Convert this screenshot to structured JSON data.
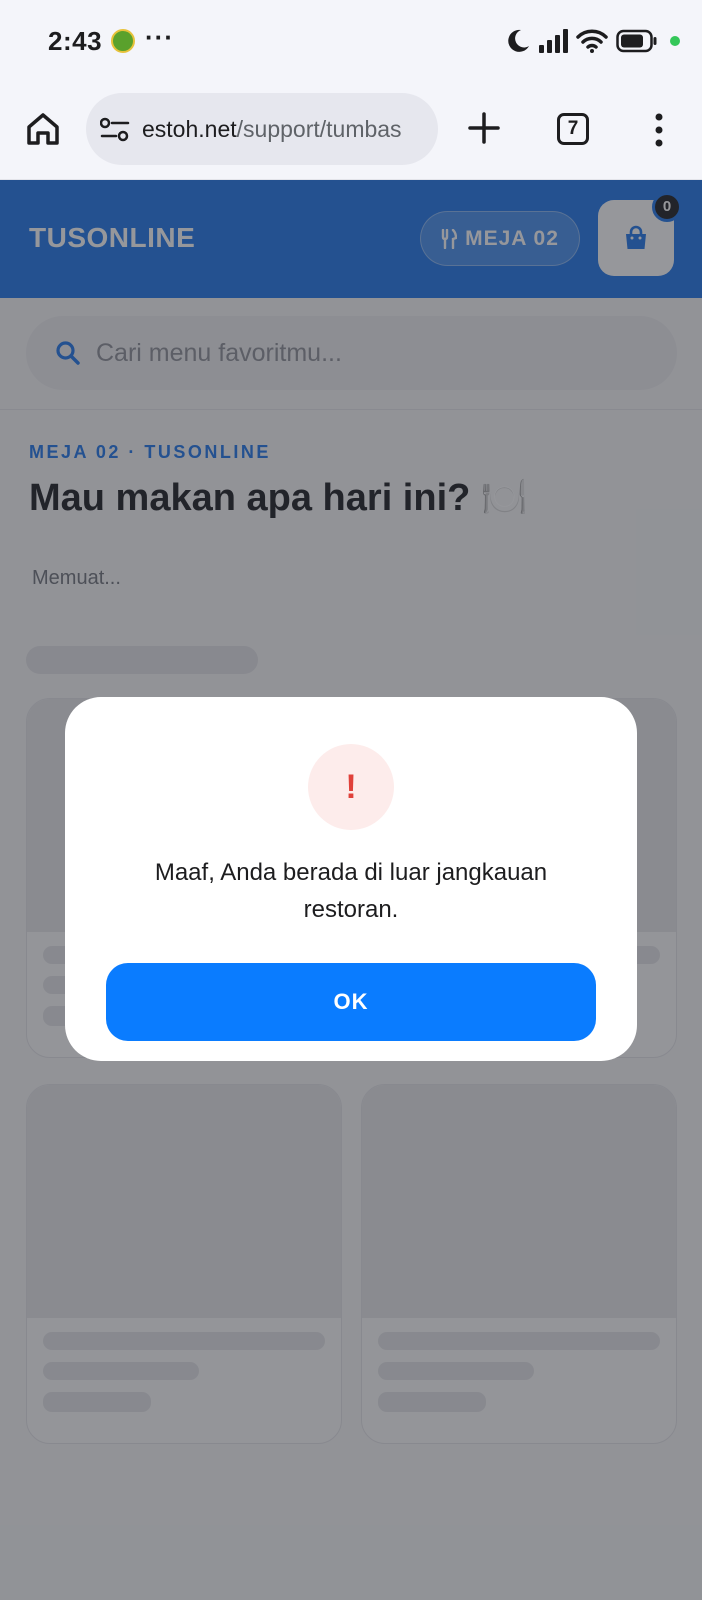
{
  "status_bar": {
    "time": "2:43",
    "overflow": "···",
    "icons": [
      "sticker-emoji-icon",
      "moon-icon",
      "signal-icon",
      "wifi-icon",
      "battery-icon",
      "status-dot-icon"
    ]
  },
  "browser": {
    "url_domain": "estoh.net",
    "url_path": "/support/tumbas",
    "tab_count": "7",
    "icons": [
      "home-icon",
      "site-settings-icon",
      "plus-icon",
      "menu-dots-icon"
    ]
  },
  "header": {
    "brand": "TUSONLINE",
    "table_label": "MEJA 02",
    "cart_count": "0",
    "colors": {
      "primary": "#1a73e8"
    }
  },
  "search": {
    "placeholder": "Cari menu favoritmu..."
  },
  "hero": {
    "eyebrow": "MEJA 02 · TUSONLINE",
    "title": "Mau makan apa hari ini? 🍽️",
    "loading": "Memuat..."
  },
  "dialog": {
    "icon_glyph": "!",
    "message": "Maaf, Anda berada di luar jangkauan restoran.",
    "ok_label": "OK",
    "colors": {
      "button": "#0a7cff",
      "alert": "#e0413a"
    }
  }
}
